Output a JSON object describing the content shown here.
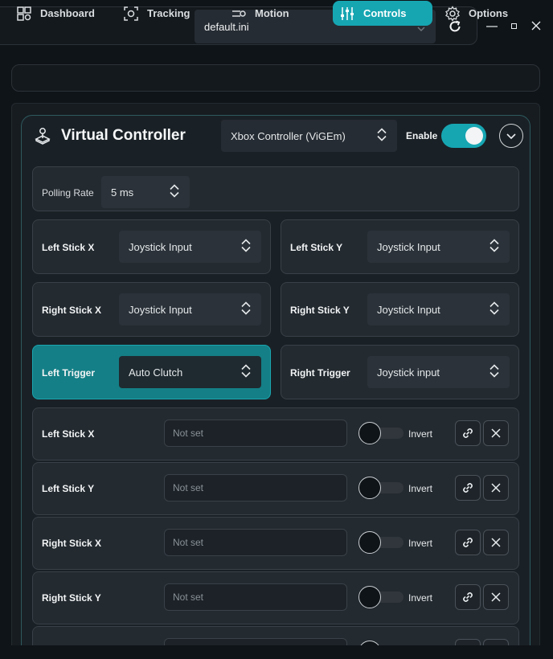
{
  "toolbar": {
    "config_file": "default.ini"
  },
  "nav": {
    "tabs": [
      {
        "label": "Dashboard",
        "icon": "dashboard-icon"
      },
      {
        "label": "Tracking",
        "icon": "tracking-icon"
      },
      {
        "label": "Motion",
        "icon": "motion-icon"
      },
      {
        "label": "Controls",
        "icon": "sliders-icon",
        "active": true
      },
      {
        "label": "Options",
        "icon": "gear-icon"
      }
    ]
  },
  "controller": {
    "title": "Virtual Controller",
    "device": "Xbox Controller (ViGEm)",
    "enable_label": "Enable",
    "enabled": true,
    "polling_label": "Polling Rate",
    "polling_value": "5 ms",
    "axes": [
      {
        "label": "Left Stick X",
        "value": "Joystick Input"
      },
      {
        "label": "Left Stick Y",
        "value": "Joystick Input"
      },
      {
        "label": "Right Stick X",
        "value": "Joystick Input"
      },
      {
        "label": "Right Stick Y",
        "value": "Joystick Input"
      },
      {
        "label": "Left Trigger",
        "value": "Auto Clutch",
        "highlighted": true
      },
      {
        "label": "Right Trigger",
        "value": "Joystick input"
      }
    ],
    "bindings": [
      {
        "label": "Left Stick X",
        "placeholder": "Not set",
        "invert_label": "Invert"
      },
      {
        "label": "Left Stick Y",
        "placeholder": "Not set",
        "invert_label": "Invert"
      },
      {
        "label": "Right Stick X",
        "placeholder": "Not set",
        "invert_label": "Invert"
      },
      {
        "label": "Right Stick Y",
        "placeholder": "Not set",
        "invert_label": "Invert"
      }
    ]
  },
  "colors": {
    "accent": "#16a6b2",
    "background": "#0f1418",
    "card": "#232a30"
  }
}
